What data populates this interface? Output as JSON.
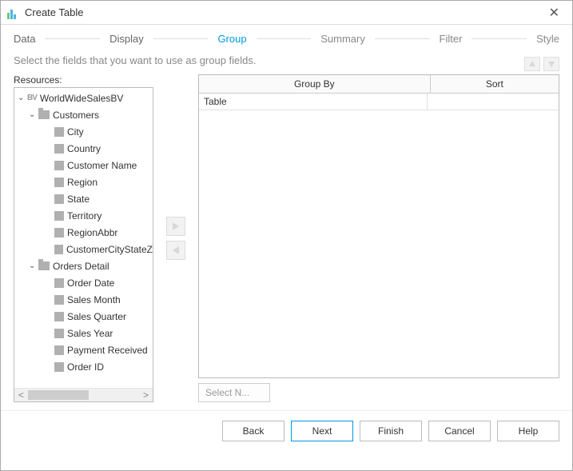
{
  "title": "Create Table",
  "steps": {
    "data": "Data",
    "display": "Display",
    "group": "Group",
    "summary": "Summary",
    "filter": "Filter",
    "style": "Style"
  },
  "instruction": "Select the fields that you want to use as group fields.",
  "resources_label": "Resources:",
  "tree": {
    "root": "WorldWideSalesBV",
    "customers": {
      "label": "Customers",
      "fields": [
        "City",
        "Country",
        "Customer Name",
        "Region",
        "State",
        "Territory",
        "RegionAbbr",
        "CustomerCityStateZ"
      ]
    },
    "orders_detail": {
      "label": "Orders Detail",
      "fields": [
        "Order Date",
        "Sales Month",
        "Sales Quarter",
        "Sales Year",
        "Payment Received",
        "Order ID"
      ]
    }
  },
  "grid": {
    "col_group_by": "Group By",
    "col_sort": "Sort",
    "rows": [
      {
        "group_by": "Table",
        "sort": ""
      }
    ]
  },
  "select_n": "Select N...",
  "buttons": {
    "back": "Back",
    "next": "Next",
    "finish": "Finish",
    "cancel": "Cancel",
    "help": "Help"
  }
}
